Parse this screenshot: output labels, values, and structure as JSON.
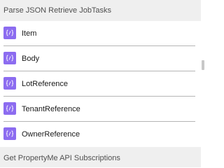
{
  "sections": {
    "top_title": "Parse JSON Retrieve JobTasks",
    "bottom_title": "Get PropertyMe API Subscriptions"
  },
  "items": [
    {
      "label": "Item",
      "icon": "expression-icon"
    },
    {
      "label": "Body",
      "icon": "expression-icon"
    },
    {
      "label": "LotReference",
      "icon": "expression-icon"
    },
    {
      "label": "TenantReference",
      "icon": "expression-icon"
    },
    {
      "label": "OwnerReference",
      "icon": "expression-icon"
    }
  ],
  "colors": {
    "badge": "#8c6cf0",
    "header_bg": "#efefef"
  }
}
